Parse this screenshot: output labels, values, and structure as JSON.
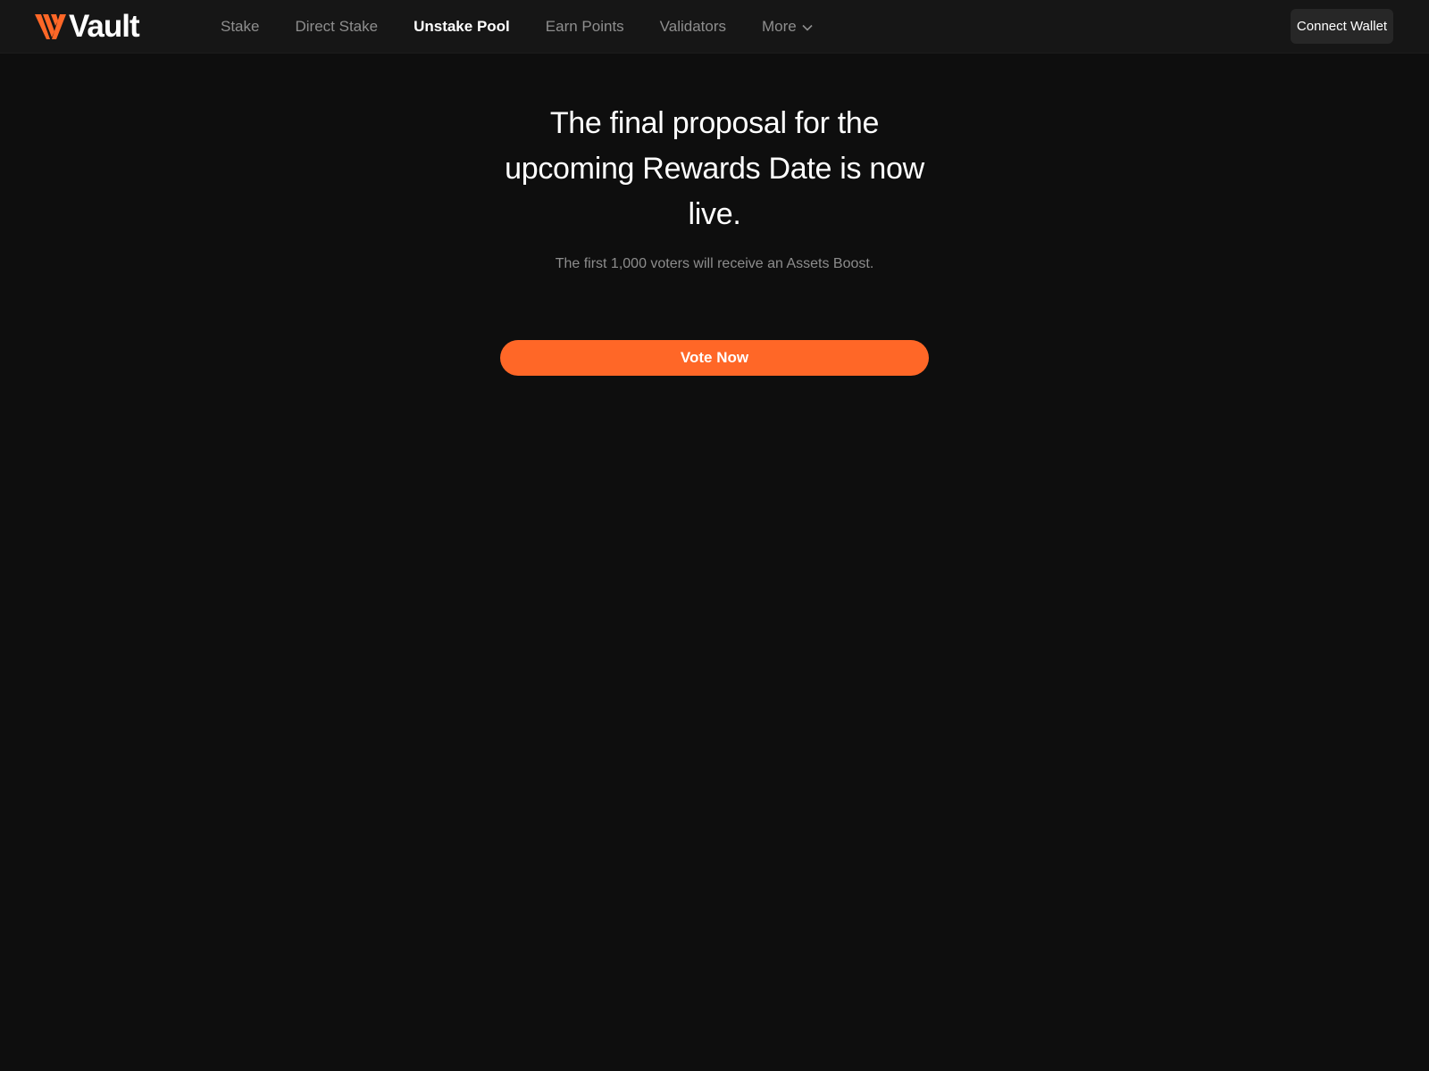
{
  "brand": {
    "name": "Vault",
    "accent": "#ff6727",
    "logo_icon": "vault-v-logo"
  },
  "nav": {
    "items": [
      {
        "label": "Stake",
        "active": false
      },
      {
        "label": "Direct Stake",
        "active": false
      },
      {
        "label": "Unstake Pool",
        "active": true
      },
      {
        "label": "Earn Points",
        "active": false
      },
      {
        "label": "Validators",
        "active": false
      },
      {
        "label": "More",
        "active": false,
        "icon": "chevron-down-icon"
      }
    ],
    "connect_label": "Connect Wallet"
  },
  "hero": {
    "title": "The final proposal for the upcoming Rewards Date is now live.",
    "subtitle": "The first 1,000 voters will receive an Assets Boost.",
    "cta_label": "Vote Now"
  },
  "colors": {
    "background": "#0e0e0e",
    "navbar": "#161616",
    "muted_text": "#8e8e8e",
    "button_dark": "#272727"
  }
}
